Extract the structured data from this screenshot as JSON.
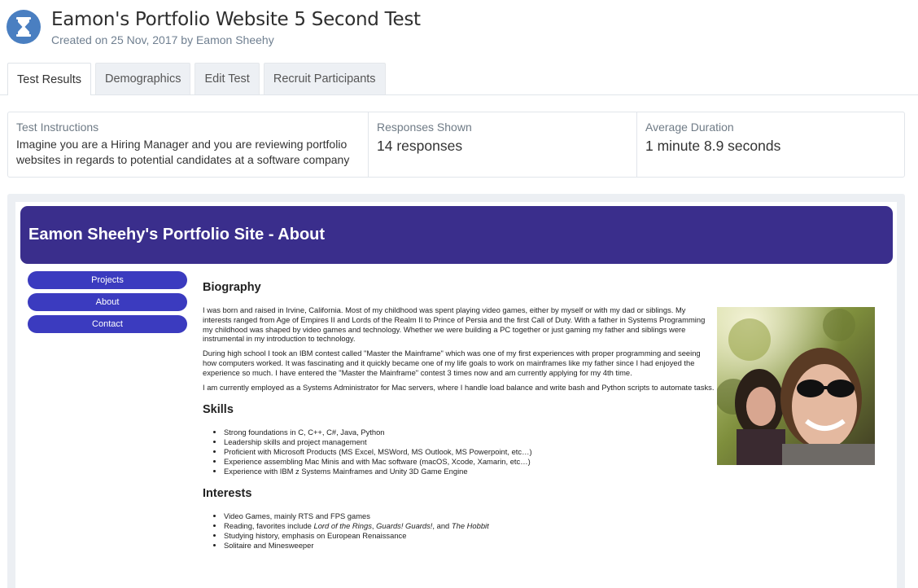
{
  "header": {
    "title": "Eamon's Portfolio Website 5 Second Test",
    "subtitle": "Created on 25 Nov, 2017 by Eamon Sheehy",
    "icon": "hourglass-icon"
  },
  "tabs": [
    {
      "label": "Test Results",
      "active": true
    },
    {
      "label": "Demographics"
    },
    {
      "label": "Edit Test"
    },
    {
      "label": "Recruit Participants"
    }
  ],
  "stats": {
    "instructions": {
      "label": "Test Instructions",
      "text": "Imagine you are a Hiring Manager and you are reviewing portfolio websites in regards to potential candidates at a software company"
    },
    "responses": {
      "label": "Responses Shown",
      "value": "14 responses"
    },
    "duration": {
      "label": "Average Duration",
      "value": "1 minute 8.9 seconds"
    }
  },
  "site": {
    "title": "Eamon Sheehy's Portfolio Site - About",
    "nav": [
      "Projects",
      "About",
      "Contact"
    ],
    "biography": {
      "heading": "Biography",
      "paragraphs": [
        "I was born and raised in Irvine, California. Most of my childhood was spent playing video games, either by myself or with my dad or siblings. My interests ranged from Age of Empires II and Lords of the Realm II to Prince of Persia and the first Call of Duty. With a father in Systems Programming my childhood was shaped by video games and technology. Whether we were building a PC together or just gaming my father and siblings were instrumental in my introduction to technology.",
        "During high school I took an IBM contest called \"Master the Mainframe\" which was one of my first experiences with proper programming and seeing how computers worked. It was fascinating and it quickly became one of my life goals to work on mainframes like my father since I had enjoyed the experience so much. I have entered the \"Master the Mainframe\" contest 3 times now and am currently applying for my 4th time.",
        "I am currently employed as a Systems Administrator for Mac servers, where I handle load balance and write bash and Python scripts to automate tasks."
      ]
    },
    "skills": {
      "heading": "Skills",
      "items": [
        "Strong foundations in C, C++, C#, Java, Python",
        "Leadership skills and project management",
        "Proficient with Microsoft Products (MS Excel, MSWord, MS Outlook, MS Powerpoint, etc…)",
        "Experience assembling Mac Minis and with Mac software (macOS, Xcode, Xamarin, etc…)",
        "Experience with IBM z Systems Mainframes and Unity 3D Game Engine"
      ]
    },
    "interests": {
      "heading": "Interests",
      "items": [
        "Video Games, mainly RTS and FPS games",
        "Studying history, emphasis on European Renaissance",
        "Solitaire and Minesweeper"
      ],
      "reading": {
        "prefix": "Reading, favorites include ",
        "book1": "Lord of the Rings",
        "sep1": ", ",
        "book2": "Guards! Guards!",
        "sep2": ", and ",
        "book3": "The Hobbit"
      }
    },
    "photo_icon": "selfie-photo"
  },
  "colors": {
    "accent": "#4a7fc1",
    "site_header": "#3a2e8c",
    "nav_button": "#3b3bbf"
  }
}
